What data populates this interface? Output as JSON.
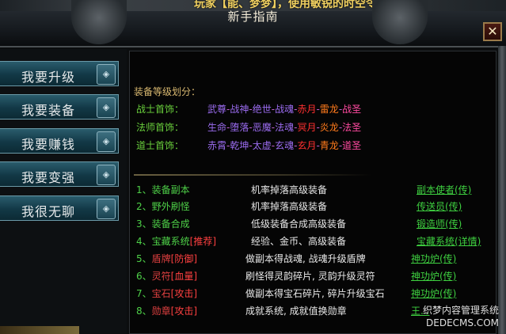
{
  "window": {
    "top_notice": "玩家【能、梦梦】，使用敏锐的时空令",
    "title": "新手指南",
    "close_label": "✕"
  },
  "sidebar": {
    "items": [
      {
        "label": "我要升级"
      },
      {
        "label": "我要装备"
      },
      {
        "label": "我要赚钱"
      },
      {
        "label": "我要变强"
      },
      {
        "label": "我很无聊"
      }
    ]
  },
  "equipment_tiers": {
    "title": "装备等级划分：",
    "rows": [
      {
        "label": "战士首饰：",
        "tiers": [
          "武尊",
          "战神",
          "绝世",
          "战魂",
          "赤月",
          "雷龙",
          "战圣"
        ]
      },
      {
        "label": "法师首饰：",
        "tiers": [
          "生命",
          "堕落",
          "恶魔",
          "法魂",
          "冥月",
          "炎龙",
          "法圣"
        ]
      },
      {
        "label": "道士首饰：",
        "tiers": [
          "赤霄",
          "乾坤",
          "太虚",
          "玄魂",
          "玄月",
          "青龙",
          "道圣"
        ]
      }
    ],
    "tier_colors": [
      "#9b6cf0",
      "#9b6cf0",
      "#9b6cf0",
      "#9b6cf0",
      "#ff3030",
      "#ff7a1c",
      "#ff4aa0"
    ],
    "separator": "-"
  },
  "guide_items": [
    {
      "num": "1、",
      "name": "装备副本",
      "tag": "",
      "desc": "机率掉落高级装备",
      "link": "副本使者(传)"
    },
    {
      "num": "2、",
      "name": "野外刷怪",
      "tag": "",
      "desc": "机率掉落高级装备",
      "link": "传送员(传)"
    },
    {
      "num": "3、",
      "name": "装备合成",
      "tag": "",
      "desc": "低级装备合成高级装备",
      "link": "锻造师(传)"
    },
    {
      "num": "4、",
      "name": "宝藏系统",
      "tag": "[推荐]",
      "desc": "经验、金币、高级装备",
      "link": "宝藏系统(详情)"
    },
    {
      "num": "5、",
      "name": "盾牌",
      "tag": "[防御]",
      "desc": "做副本得战魂, 战魂升级盾牌",
      "link": "神功炉(传)"
    },
    {
      "num": "6、",
      "name": "灵符",
      "tag": "[血量]",
      "desc": "刷怪得灵韵碎片, 灵韵升级灵符",
      "link": "神功炉(传)"
    },
    {
      "num": "7、",
      "name": "宝石",
      "tag": "[攻击]",
      "desc": "做副本得宝石碎片, 碎片升级宝石",
      "link": "神功炉(传)"
    },
    {
      "num": "8、",
      "name": "勋章",
      "tag": "[攻击]",
      "desc": "成就系统, 成就值换勋章",
      "link": "王..."
    }
  ],
  "site_mark": {
    "line1": "织梦内容管理系统",
    "line2": "DEDECMS.COM"
  }
}
